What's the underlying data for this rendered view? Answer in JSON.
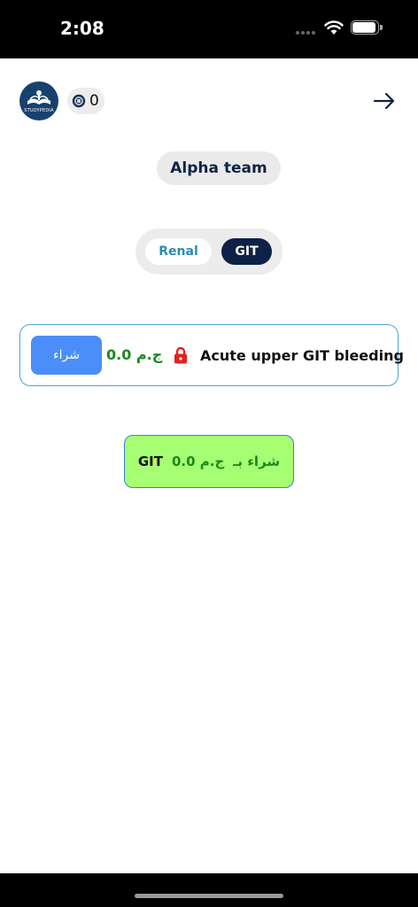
{
  "status_bar": {
    "time": "2:08",
    "icons": [
      "cellular-dots-icon",
      "wifi-icon",
      "battery-icon"
    ]
  },
  "header": {
    "logo_text": "STUDYPEDIA",
    "coin_icon": "coin-icon",
    "coin_count": "0",
    "forward_icon": "arrow-right-icon"
  },
  "team": {
    "name": "Alpha team"
  },
  "tabs": [
    {
      "label": "Renal",
      "selected": false
    },
    {
      "label": "GIT",
      "selected": true
    }
  ],
  "card": {
    "title": "Acute upper GIT bleeding",
    "price": "0.0 ج.م",
    "buy_label": "شراء",
    "locked": true
  },
  "bulk_buy": {
    "label": "شراء بـ",
    "price": "0.0 ج.م",
    "topic": "GIT"
  },
  "colors": {
    "navy": "#0e2247",
    "accent_blue": "#4b8ef9",
    "price_green": "#1a8a1a",
    "bulk_bg": "#a6ff73",
    "lock_red": "#e8201d"
  }
}
